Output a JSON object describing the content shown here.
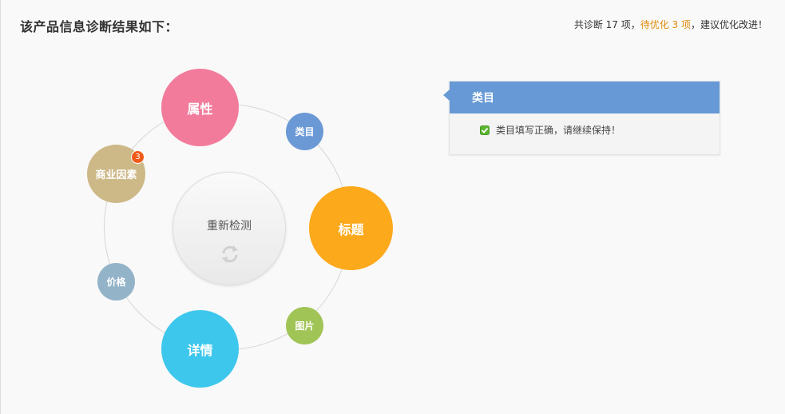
{
  "header": {
    "title": "该产品信息诊断结果如下："
  },
  "summary": {
    "prefix": "共诊断 17 项，",
    "warn": "待优化 3 项",
    "suffix": "，建议优化改进！"
  },
  "recheck": {
    "label": "重新检测"
  },
  "bubbles": {
    "attr": "属性",
    "category": "类目",
    "business": "商业因素",
    "title": "标题",
    "price": "价格",
    "image": "图片",
    "detail": "详情"
  },
  "badge": {
    "count": "3"
  },
  "panel": {
    "title": "类目",
    "message": "类目填写正确，请继续保持！"
  },
  "colors": {
    "attr": "#f27b9b",
    "category": "#6b99d6",
    "business": "#cdb888",
    "title": "#fda91c",
    "price": "#93b3c8",
    "image": "#a1c457",
    "detail": "#3dc7ec",
    "badge": "#f05a18",
    "panel_head": "#6699d6",
    "warn_text": "#e08a0a"
  },
  "icons": {
    "recheck": "refresh-icon",
    "panel_row": "check-icon"
  }
}
